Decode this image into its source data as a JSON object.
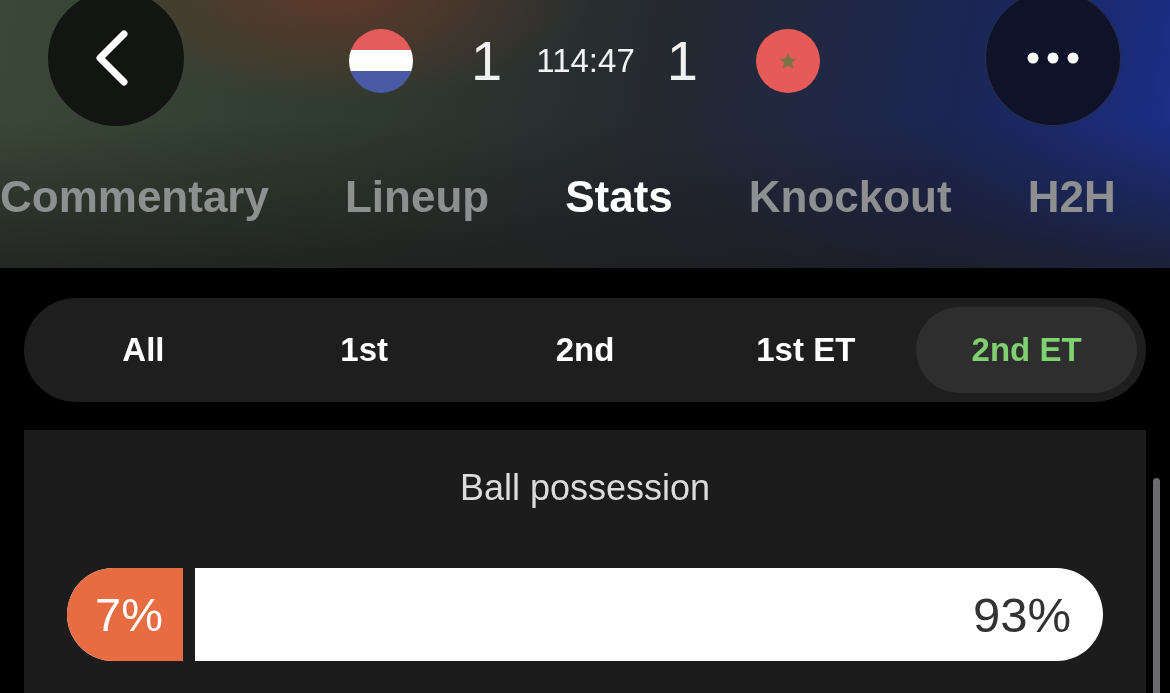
{
  "header": {
    "home_score": "1",
    "clock": "114:47",
    "away_score": "1"
  },
  "tabs": [
    {
      "label": "Commentary",
      "selected": false
    },
    {
      "label": "Lineup",
      "selected": false
    },
    {
      "label": "Stats",
      "selected": true
    },
    {
      "label": "Knockout",
      "selected": false
    },
    {
      "label": "H2H",
      "selected": false
    }
  ],
  "periods": [
    {
      "label": "All",
      "selected": false
    },
    {
      "label": "1st",
      "selected": false
    },
    {
      "label": "2nd",
      "selected": false
    },
    {
      "label": "1st ET",
      "selected": false
    },
    {
      "label": "2nd ET",
      "selected": true
    }
  ],
  "stats": [
    {
      "label": "Ball possession",
      "home": "7%",
      "away": "93%",
      "level": 0.07
    }
  ]
}
